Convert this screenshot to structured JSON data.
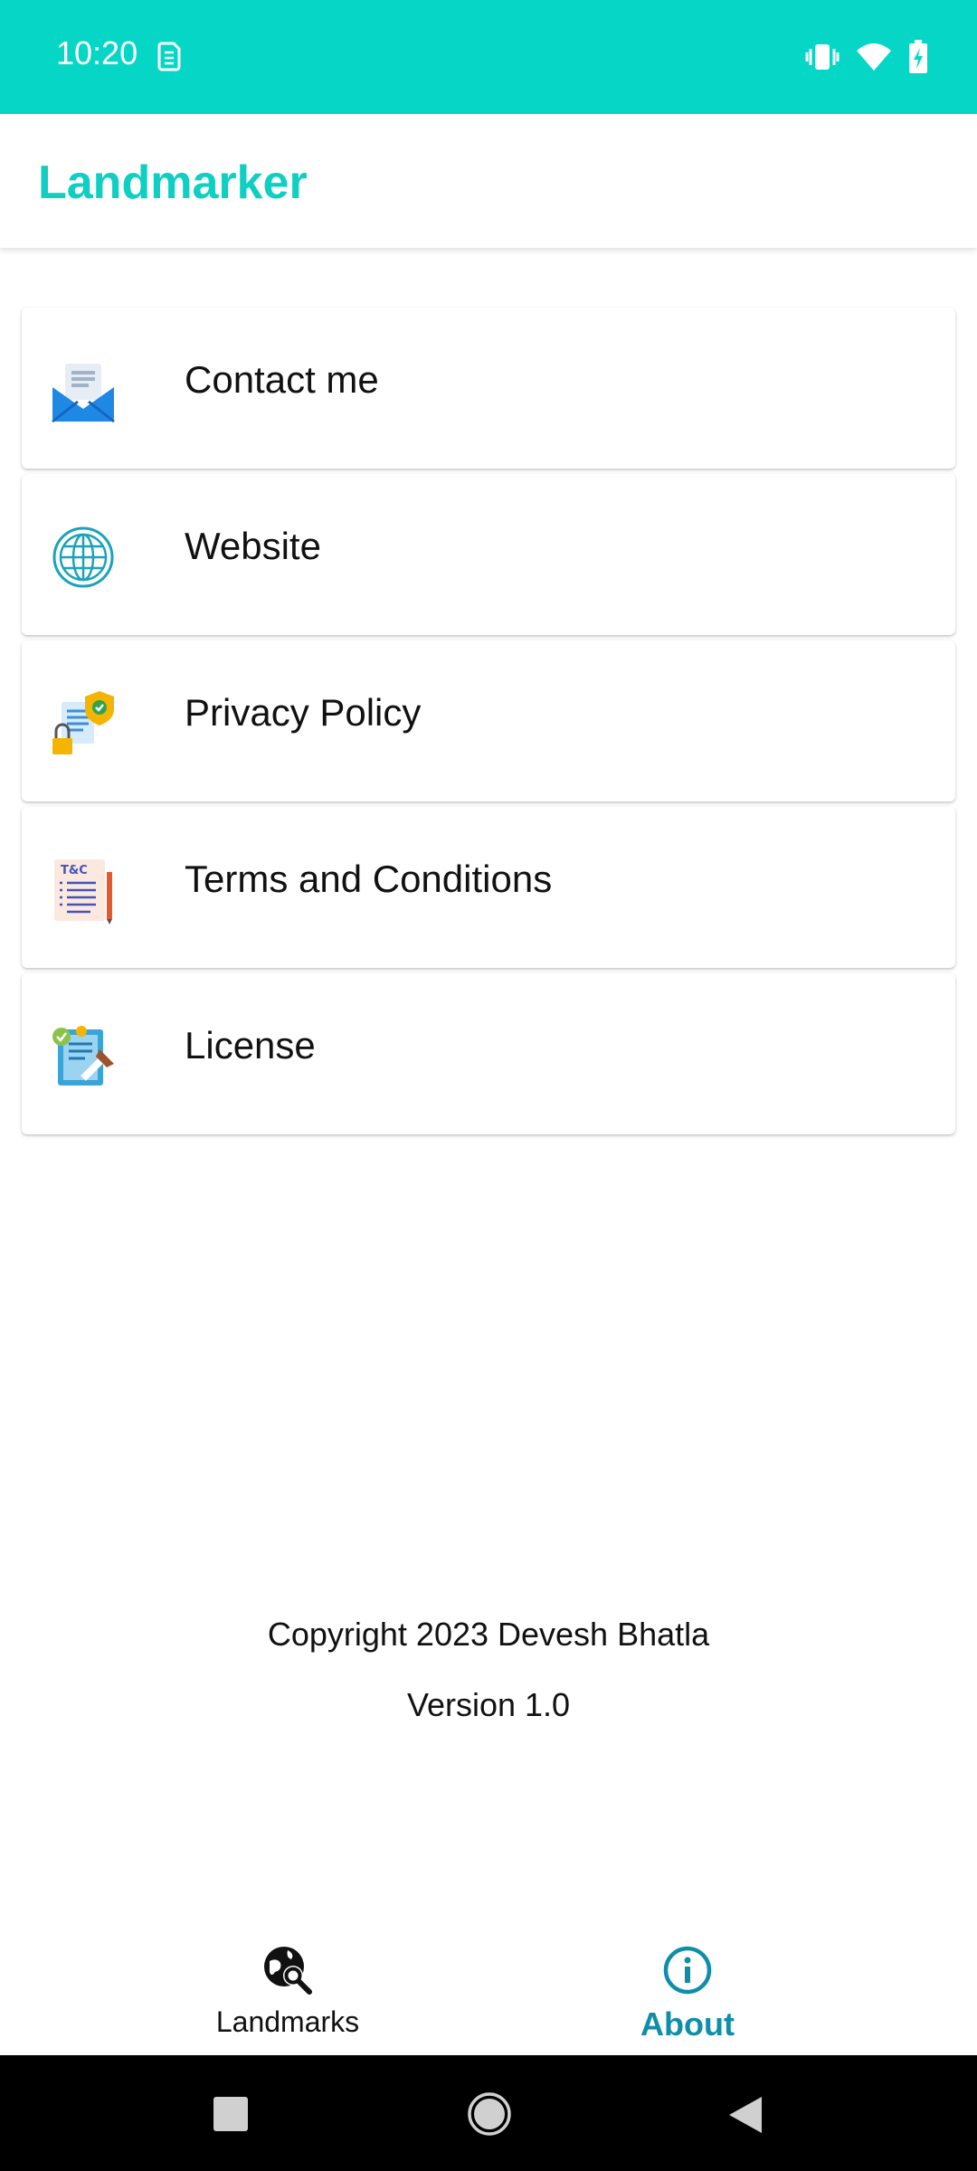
{
  "status_bar": {
    "time": "10:20",
    "left_icon": "sim-card-icon",
    "right_icons": [
      "vibrate-icon",
      "wifi-icon",
      "battery-charging-icon"
    ]
  },
  "app_bar": {
    "title": "Landmarker"
  },
  "menu": {
    "items": [
      {
        "label": "Contact me",
        "icon": "mail-icon"
      },
      {
        "label": "Website",
        "icon": "globe-icon"
      },
      {
        "label": "Privacy Policy",
        "icon": "privacy-shield-icon"
      },
      {
        "label": "Terms and Conditions",
        "icon": "terms-document-icon"
      },
      {
        "label": "License",
        "icon": "license-certificate-icon"
      }
    ]
  },
  "footer": {
    "copyright": "Copyright 2023 Devesh Bhatla",
    "version": "Version 1.0"
  },
  "bottom_nav": {
    "items": [
      {
        "label": "Landmarks",
        "icon": "globe-search-icon",
        "active": false
      },
      {
        "label": "About",
        "icon": "info-icon",
        "active": true
      }
    ]
  },
  "colors": {
    "status_bar": "#05d6c6",
    "title": "#0fcfc3",
    "active_nav": "#0e8ea8"
  }
}
